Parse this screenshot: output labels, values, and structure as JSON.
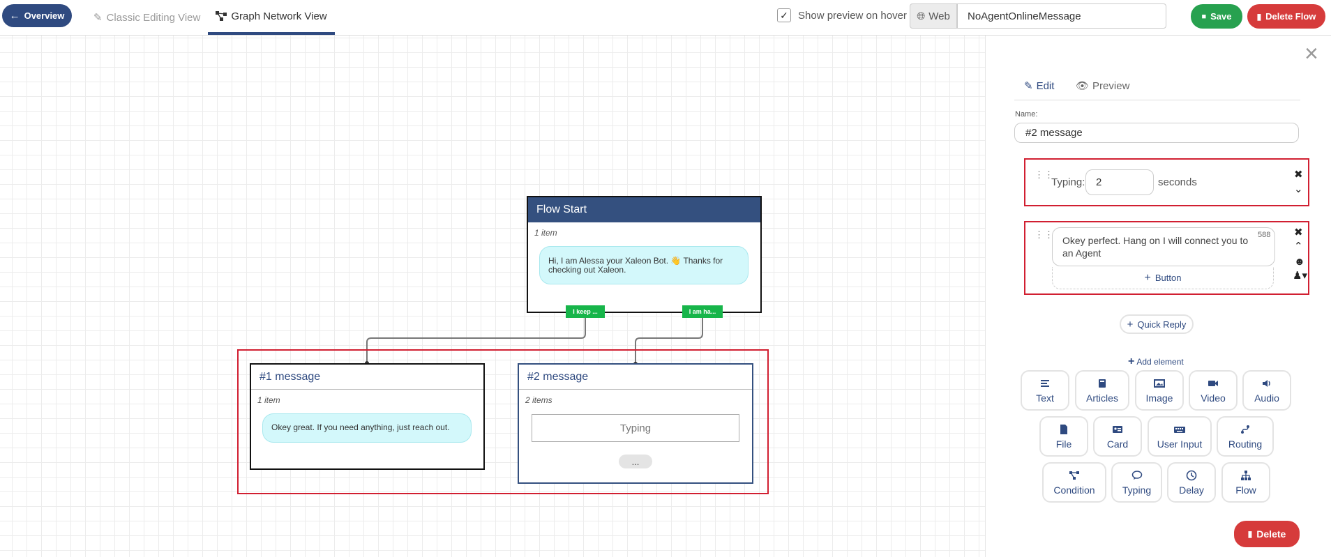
{
  "topbar": {
    "overview_label": "Overview",
    "tab_classic": "Classic Editing View",
    "tab_graph": "Graph Network View",
    "preview_checked": "✓",
    "preview_label": "Show preview on hover",
    "channel": "Web",
    "flow_name": "NoAgentOnlineMessage",
    "save_label": "Save",
    "delete_flow_label": "Delete Flow"
  },
  "canvas": {
    "flow_start": {
      "title": "Flow Start",
      "count": "1  item",
      "message": "Hi, I am Alessa your Xaleon Bot. 👋 Thanks for checking out Xaleon.",
      "buttons": [
        "I keep ...",
        "I am ha..."
      ]
    },
    "msg1": {
      "title": "#1 message",
      "count": "1  item",
      "message": "Okey great. If you need anything, just reach out."
    },
    "msg2": {
      "title": "#2 message",
      "count": "2  items",
      "typing_label": "Typing",
      "more_label": "..."
    }
  },
  "panel": {
    "tab_edit": "Edit",
    "tab_preview": "Preview",
    "name_label": "Name:",
    "name_value": "#2 message",
    "typing_label": "Typing:",
    "typing_value": "2",
    "typing_unit": "seconds",
    "message_text": "Okey perfect. Hang on I will connect you to an Agent",
    "char_count": "588",
    "button_label": "Button",
    "quick_reply_label": "Quick Reply",
    "add_element_label": "Add element",
    "elements": [
      {
        "label": "Text",
        "icon": "text-icon"
      },
      {
        "label": "Articles",
        "icon": "book-icon"
      },
      {
        "label": "Image",
        "icon": "image-icon"
      },
      {
        "label": "Video",
        "icon": "video-icon"
      },
      {
        "label": "Audio",
        "icon": "audio-icon"
      },
      {
        "label": "File",
        "icon": "file-icon"
      },
      {
        "label": "Card",
        "icon": "card-icon"
      },
      {
        "label": "User Input",
        "icon": "keyboard-icon"
      },
      {
        "label": "Routing",
        "icon": "routing-icon"
      },
      {
        "label": "Condition",
        "icon": "condition-icon"
      },
      {
        "label": "Typing",
        "icon": "comment-icon"
      },
      {
        "label": "Delay",
        "icon": "clock-icon"
      },
      {
        "label": "Flow",
        "icon": "sitemap-icon"
      }
    ],
    "delete_label": "Delete"
  },
  "colors": {
    "primary": "#2f4a80",
    "success": "#27a14f",
    "danger": "#d63b3b",
    "highlight": "#d11f31",
    "bubble": "#d3f8fb",
    "tag": "#17b54a"
  }
}
